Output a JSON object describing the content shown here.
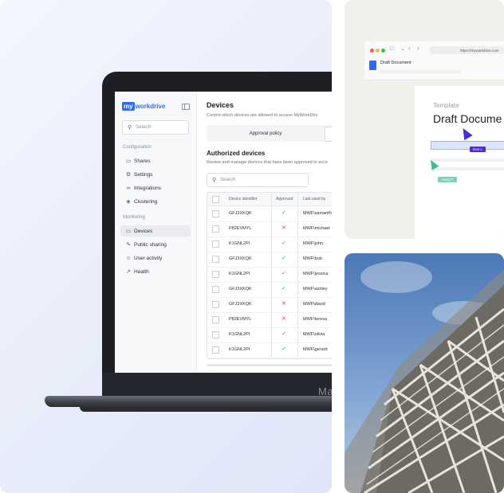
{
  "app": {
    "logo_prefix": "my",
    "logo_suffix": "workdrive"
  },
  "laptop_brand": "Ma",
  "sidebar": {
    "search_placeholder": "Search",
    "configuration_label": "Configuration",
    "monitoring_label": "Monitoring",
    "config_items": [
      {
        "label": "Shares",
        "icon": "folder-icon"
      },
      {
        "label": "Settings",
        "icon": "gear-icon"
      },
      {
        "label": "Integrations",
        "icon": "link-icon"
      },
      {
        "label": "Clustering",
        "icon": "layers-icon"
      }
    ],
    "monitor_items": [
      {
        "label": "Devices",
        "icon": "monitor-icon",
        "active": true
      },
      {
        "label": "Public sharing",
        "icon": "share-icon"
      },
      {
        "label": "User activity",
        "icon": "users-icon"
      },
      {
        "label": "Health",
        "icon": "chart-icon"
      }
    ]
  },
  "main": {
    "title": "Devices",
    "subtitle": "Control which devices are allowed to access MyWorkDriv",
    "tab_active": "Approval policy",
    "section_title": "Authorized devices",
    "section_subtitle": "Review and manage devices that have been approved to acce",
    "search_placeholder": "Search",
    "columns": [
      "Device identifier",
      "Approved",
      "Last used by"
    ],
    "rows": [
      {
        "id": "GFJ3XKQK",
        "approved": true,
        "user": "MWF\\samanth"
      },
      {
        "id": "P82EVMYL",
        "approved": false,
        "user": "MWF\\michael"
      },
      {
        "id": "K1GNL2PI",
        "approved": true,
        "user": "MWF\\john"
      },
      {
        "id": "GFJ3XKQK",
        "approved": true,
        "user": "MWF\\bob"
      },
      {
        "id": "K1GNL2PI",
        "approved": true,
        "user": "MWF\\jessica"
      },
      {
        "id": "GFJ3XKQK",
        "approved": true,
        "user": "MWF\\ashley"
      },
      {
        "id": "GFJ3XKQK",
        "approved": false,
        "user": "MWF\\david"
      },
      {
        "id": "P82EVMYL",
        "approved": false,
        "user": "MWF\\teresa"
      },
      {
        "id": "K1GNL2PI",
        "approved": true,
        "user": "MWF\\olivia"
      },
      {
        "id": "K1GNL2PI",
        "approved": true,
        "user": "MWF\\gerard"
      }
    ]
  },
  "document": {
    "url": "https://myworkdrive.com",
    "file_title": "Draft Document",
    "template_label": "Template",
    "template_title": "Draft Docume",
    "cursor_tag_1": "Don L",
    "cursor_tag_2": "Anna T"
  },
  "colors": {
    "brand": "#2f6bf2",
    "approved": "#2eaa5c",
    "denied": "#e0463e",
    "cursor_primary": "#4a2bd6",
    "cursor_secondary": "#3fb99a"
  }
}
